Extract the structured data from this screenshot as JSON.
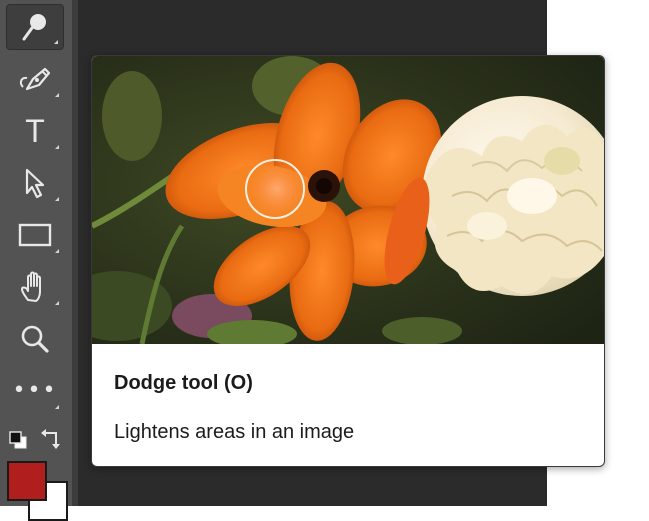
{
  "toolbar": {
    "tools": [
      {
        "name": "dodge-tool",
        "icon": "dodge-icon",
        "selected": true
      },
      {
        "name": "pen-tool",
        "icon": "pen-icon"
      },
      {
        "name": "type-tool",
        "icon": "type-icon",
        "glyph": "T"
      },
      {
        "name": "path-selection-tool",
        "icon": "arrow-icon"
      },
      {
        "name": "rectangle-tool",
        "icon": "rectangle-icon"
      },
      {
        "name": "hand-tool",
        "icon": "hand-icon"
      },
      {
        "name": "zoom-tool",
        "icon": "zoom-icon"
      },
      {
        "name": "edit-toolbar",
        "icon": "more-icon",
        "glyph": "•••"
      }
    ],
    "foreground_color": "#b01e1e",
    "background_color": "#ffffff"
  },
  "tooltip": {
    "title": "Dodge tool (O)",
    "description": "Lightens areas in an image"
  },
  "colors": {
    "toolbar_bg": "#535353",
    "workspace_bg": "#2b2b2b",
    "icon": "#e8e8e8"
  }
}
